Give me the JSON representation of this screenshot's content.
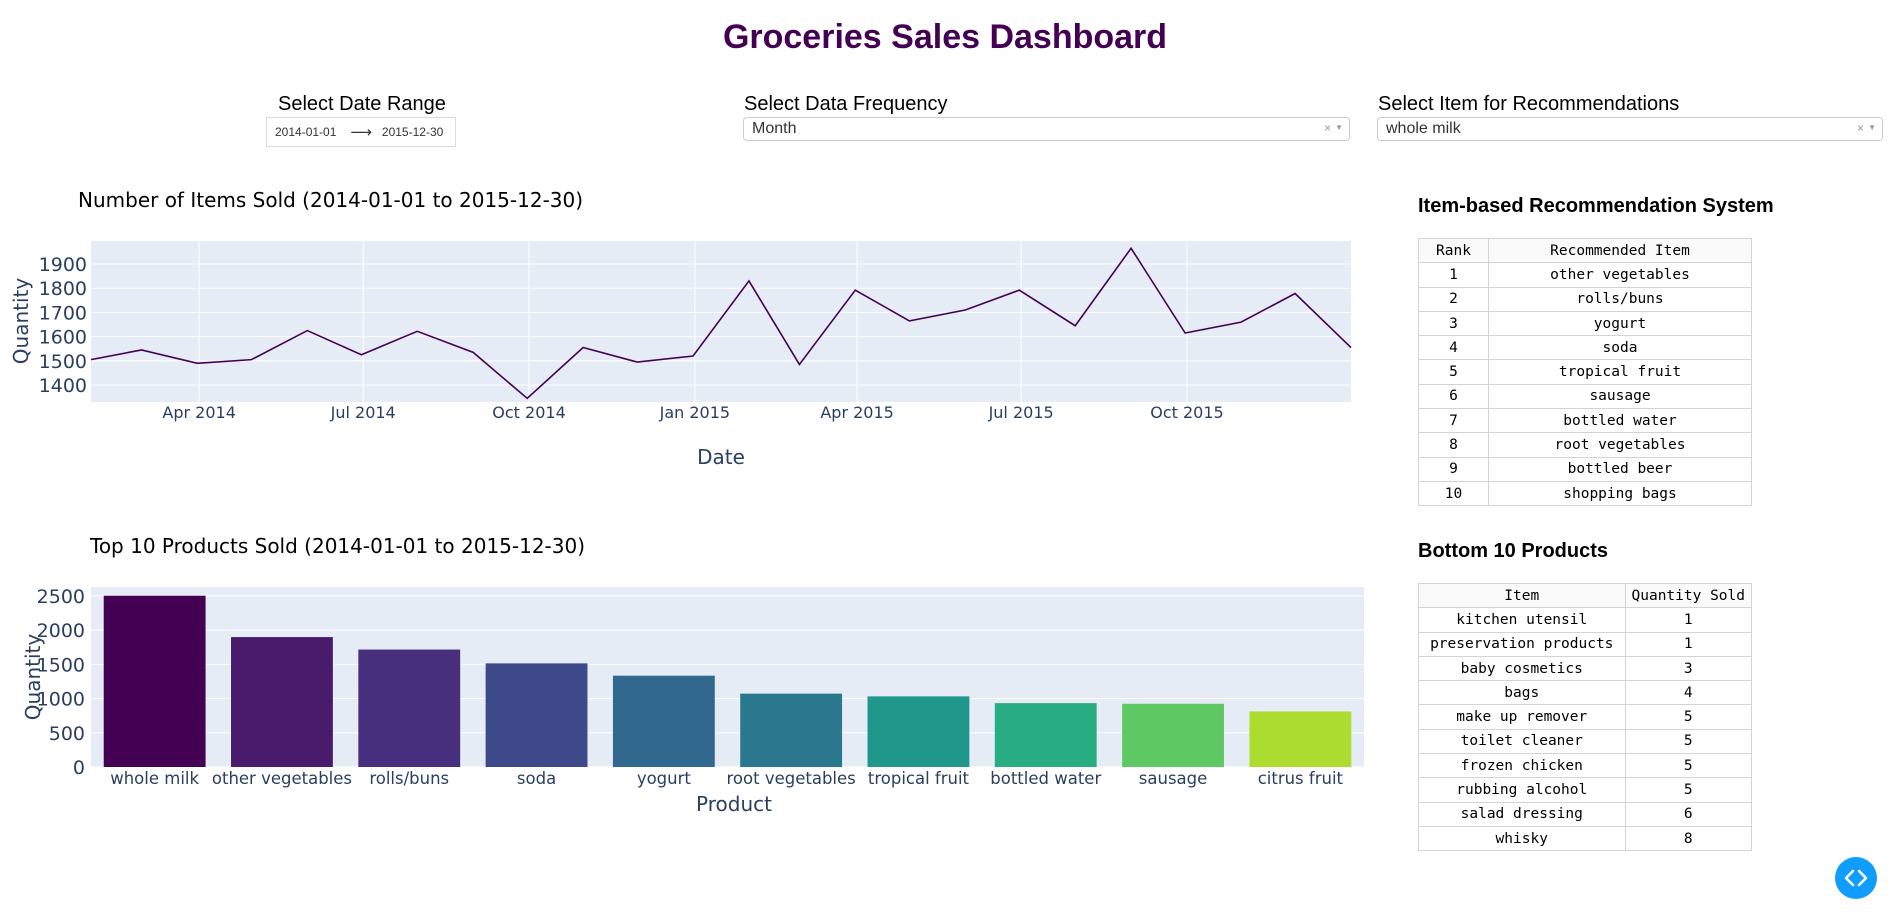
{
  "page": {
    "title": "Groceries Sales Dashboard"
  },
  "controls": {
    "date_range": {
      "label": "Select Date Range",
      "start": "2014-01-01",
      "end": "2015-12-30"
    },
    "frequency": {
      "label": "Select Data Frequency",
      "value": "Month"
    },
    "item": {
      "label": "Select Item for Recommendations",
      "value": "whole milk"
    }
  },
  "charts": {
    "line": {
      "title": "Number of Items Sold (2014-01-01 to 2015-12-30)"
    },
    "bar": {
      "title": "Top 10 Products Sold (2014-01-01 to 2015-12-30)"
    }
  },
  "recommendations": {
    "heading": "Item-based Recommendation System",
    "columns": [
      "Rank",
      "Recommended Item"
    ],
    "rows": [
      [
        "1",
        "other vegetables"
      ],
      [
        "2",
        "rolls/buns"
      ],
      [
        "3",
        "yogurt"
      ],
      [
        "4",
        "soda"
      ],
      [
        "5",
        "tropical fruit"
      ],
      [
        "6",
        "sausage"
      ],
      [
        "7",
        "bottled water"
      ],
      [
        "8",
        "root vegetables"
      ],
      [
        "9",
        "bottled beer"
      ],
      [
        "10",
        "shopping bags"
      ]
    ]
  },
  "bottom_products": {
    "heading": "Bottom 10 Products",
    "columns": [
      "Item",
      "Quantity Sold"
    ],
    "rows": [
      [
        "kitchen utensil",
        "1"
      ],
      [
        "preservation products",
        "1"
      ],
      [
        "baby cosmetics",
        "3"
      ],
      [
        "bags",
        "4"
      ],
      [
        "make up remover",
        "5"
      ],
      [
        "toilet cleaner",
        "5"
      ],
      [
        "frozen chicken",
        "5"
      ],
      [
        "rubbing alcohol",
        "5"
      ],
      [
        "salad dressing",
        "6"
      ],
      [
        "whisky",
        "8"
      ]
    ]
  },
  "debug_button": {
    "icon": "code-icon"
  },
  "colors": {
    "title": "#440154",
    "plot_bg": "#e5ecf6",
    "line": "#440154",
    "axis_text": "#2a3f5f"
  },
  "chart_data": [
    {
      "type": "line",
      "xlabel": "Date",
      "ylabel": "Quantity",
      "x": [
        "2014-01-31",
        "2014-02-28",
        "2014-03-31",
        "2014-04-30",
        "2014-05-31",
        "2014-06-30",
        "2014-07-31",
        "2014-08-31",
        "2014-09-30",
        "2014-10-31",
        "2014-11-30",
        "2014-12-31",
        "2015-01-31",
        "2015-02-28",
        "2015-03-31",
        "2015-04-30",
        "2015-05-31",
        "2015-06-30",
        "2015-07-31",
        "2015-08-31",
        "2015-09-30",
        "2015-10-31",
        "2015-11-30",
        "2015-12-31"
      ],
      "values": [
        1505,
        1545,
        1490,
        1505,
        1625,
        1525,
        1622,
        1535,
        1345,
        1555,
        1495,
        1520,
        1830,
        1485,
        1792,
        1665,
        1710,
        1792,
        1645,
        1965,
        1615,
        1660,
        1778,
        1555
      ],
      "xlim": [
        "2014-01-31",
        "2015-12-31"
      ],
      "ylim": [
        1330,
        1995
      ],
      "yticks": [
        1400,
        1500,
        1600,
        1700,
        1800,
        1900
      ],
      "xticks": [
        {
          "date": "2014-04-01",
          "label": "Apr 2014"
        },
        {
          "date": "2014-07-01",
          "label": "Jul 2014"
        },
        {
          "date": "2014-10-01",
          "label": "Oct 2014"
        },
        {
          "date": "2015-01-01",
          "label": "Jan 2015"
        },
        {
          "date": "2015-04-01",
          "label": "Apr 2015"
        },
        {
          "date": "2015-07-01",
          "label": "Jul 2015"
        },
        {
          "date": "2015-10-01",
          "label": "Oct 2015"
        }
      ],
      "grid": true
    },
    {
      "type": "bar",
      "xlabel": "Product",
      "ylabel": "Quantity",
      "categories": [
        "whole milk",
        "other vegetables",
        "rolls/buns",
        "soda",
        "yogurt",
        "root vegetables",
        "tropical fruit",
        "bottled water",
        "sausage",
        "citrus fruit"
      ],
      "values": [
        2502,
        1898,
        1716,
        1514,
        1334,
        1072,
        1032,
        933,
        924,
        812
      ],
      "colors": [
        "#440154",
        "#481a6c",
        "#472f7d",
        "#3e4989",
        "#31688e",
        "#2a788e",
        "#1f978b",
        "#27ad81",
        "#5ec962",
        "#addc30"
      ],
      "ylim": [
        0,
        2630
      ],
      "yticks": [
        0,
        500,
        1000,
        1500,
        2000,
        2500
      ],
      "grid": true
    }
  ]
}
